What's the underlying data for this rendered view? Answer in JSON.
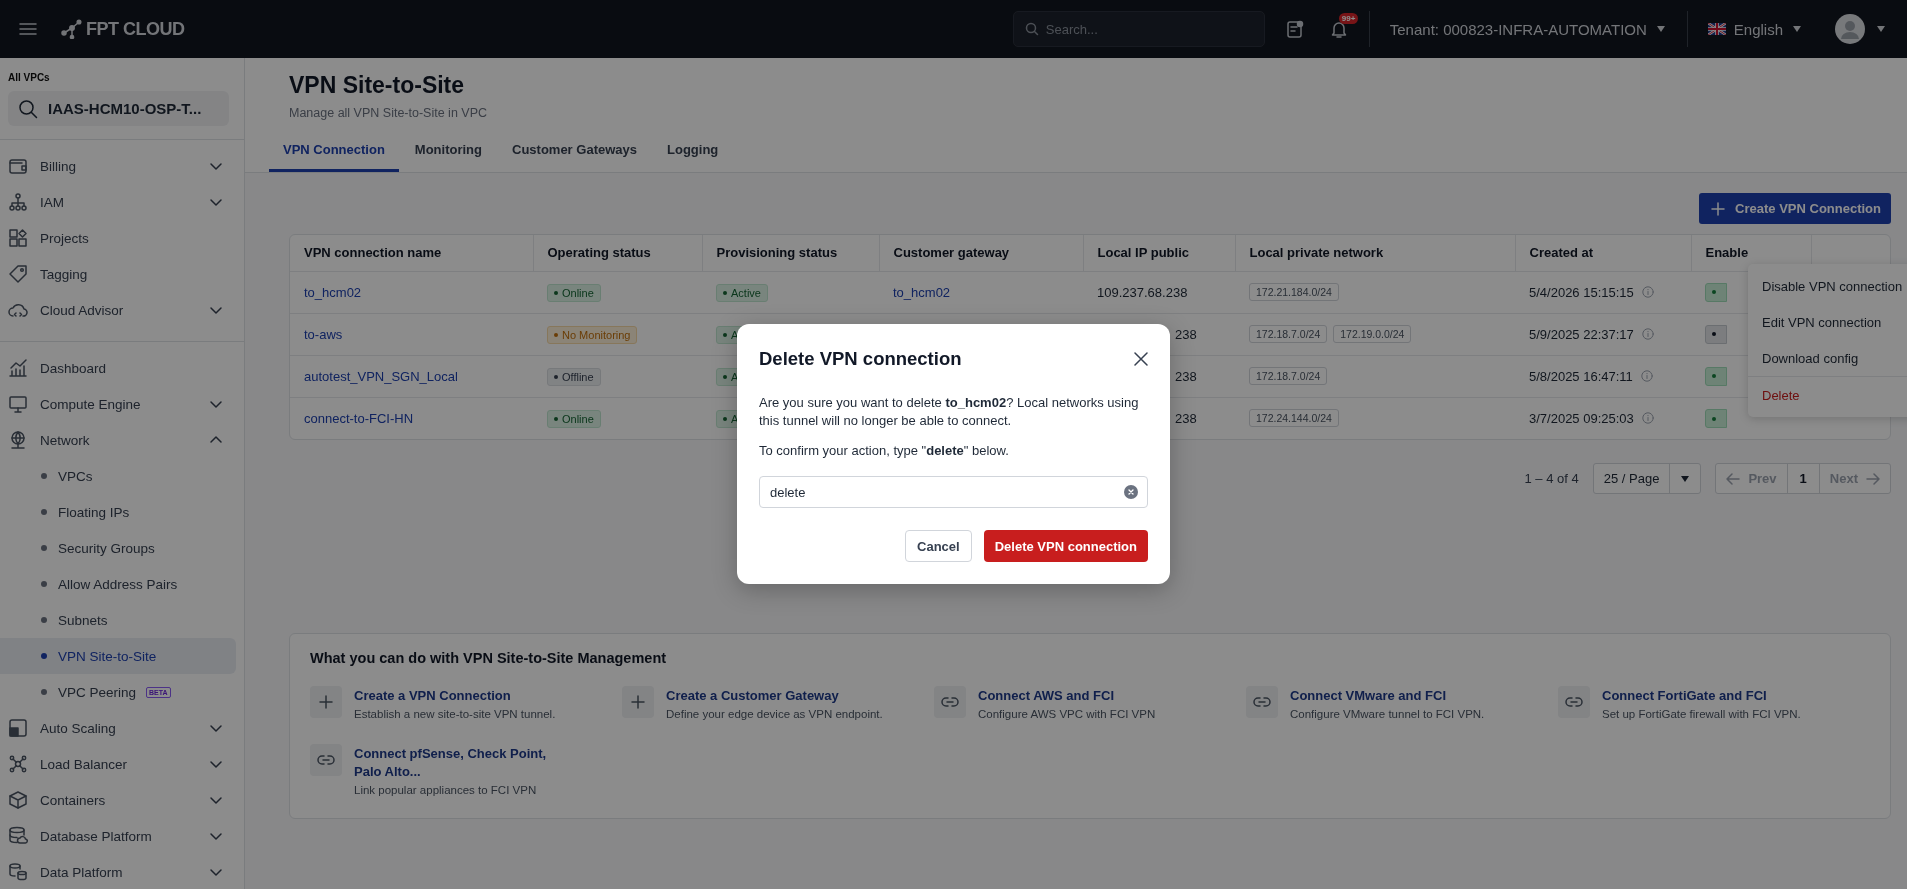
{
  "topbar": {
    "logo": "FPT CLOUD",
    "search": {
      "placeholder": "Search..."
    },
    "notifications": "99+",
    "tenant": "Tenant:  000823-INFRA-AUTOMATION",
    "language": "English"
  },
  "sidebar": {
    "scope_label": "All VPCs",
    "vpc_selector": "IAAS-HCM10-OSP-T...",
    "groups": [
      [
        {
          "label": "Billing",
          "kind": "group",
          "expanded": false
        },
        {
          "label": "IAM",
          "kind": "group",
          "expanded": false
        },
        {
          "label": "Projects",
          "kind": "link"
        },
        {
          "label": "Tagging",
          "kind": "link"
        },
        {
          "label": "Cloud Advisor",
          "kind": "group",
          "expanded": false
        }
      ],
      [
        {
          "label": "Dashboard",
          "kind": "link"
        },
        {
          "label": "Compute Engine",
          "kind": "group",
          "expanded": false
        },
        {
          "label": "Network",
          "kind": "group",
          "expanded": true,
          "children": [
            {
              "label": "VPCs",
              "selected": false
            },
            {
              "label": "Floating IPs",
              "selected": false
            },
            {
              "label": "Security Groups",
              "selected": false
            },
            {
              "label": "Allow Address Pairs",
              "selected": false
            },
            {
              "label": "Subnets",
              "selected": false
            },
            {
              "label": "VPN Site-to-Site",
              "selected": true
            },
            {
              "label": "VPC Peering",
              "selected": false,
              "badge": "BETA"
            }
          ]
        },
        {
          "label": "Auto Scaling",
          "kind": "group",
          "expanded": false
        },
        {
          "label": "Load Balancer",
          "kind": "group",
          "expanded": false
        },
        {
          "label": "Containers",
          "kind": "group",
          "expanded": false
        },
        {
          "label": "Database Platform",
          "kind": "group",
          "expanded": false
        },
        {
          "label": "Data Platform",
          "kind": "group",
          "expanded": false
        }
      ]
    ]
  },
  "page": {
    "title": "VPN Site-to-Site",
    "subtitle": "Manage all VPN Site-to-Site in VPC",
    "tabs": [
      {
        "label": "VPN Connection",
        "selected": true
      },
      {
        "label": "Monitoring",
        "selected": false
      },
      {
        "label": "Customer Gateways",
        "selected": false
      },
      {
        "label": "Logging",
        "selected": false
      }
    ],
    "create_button": "Create VPN Connection"
  },
  "table": {
    "columns": [
      "VPN connection name",
      "Operating status",
      "Provisioning status",
      "Customer gateway",
      "Local IP public",
      "Local private network",
      "Created at",
      "Enable"
    ],
    "rows": [
      {
        "name": "to_hcm02",
        "operating": {
          "kind": "online",
          "text": "Online"
        },
        "provisioning": {
          "kind": "active",
          "text": "Active"
        },
        "gateway": "to_hcm02",
        "local_ip": "109.237.68.238",
        "networks": [
          "172.21.184.0/24"
        ],
        "created": "5/4/2026 15:15:15",
        "enabled": true
      },
      {
        "name": "to-aws",
        "operating": {
          "kind": "warning",
          "text": "No Monitoring"
        },
        "provisioning": {
          "kind": "active",
          "text": "A"
        },
        "local_ip_tail": "238",
        "networks": [
          "172.18.7.0/24",
          "172.19.0.0/24"
        ],
        "created": "5/9/2025 22:37:17",
        "enabled": false
      },
      {
        "name": "autotest_VPN_SGN_Local",
        "operating": {
          "kind": "offline",
          "text": "Offline"
        },
        "provisioning": {
          "kind": "active",
          "text": "A"
        },
        "local_ip_tail": "238",
        "networks": [
          "172.18.7.0/24"
        ],
        "created": "5/8/2025 16:47:11",
        "enabled": true
      },
      {
        "name": "connect-to-FCI-HN",
        "operating": {
          "kind": "online",
          "text": "Online"
        },
        "provisioning": {
          "kind": "active",
          "text": "A"
        },
        "local_ip_tail": "238",
        "networks": [
          "172.24.144.0/24"
        ],
        "created": "3/7/2025 09:25:03",
        "enabled": true
      }
    ]
  },
  "pagination": {
    "range": "1 – 4 of 4",
    "page_size": "25 / Page",
    "prev": "Prev",
    "current": "1",
    "next": "Next"
  },
  "row_menu": [
    {
      "label": "Disable VPN connection",
      "kind": "normal"
    },
    {
      "label": "Edit VPN connection",
      "kind": "normal"
    },
    {
      "label": "Download config",
      "kind": "normal"
    },
    {
      "label": "Delete",
      "kind": "danger"
    }
  ],
  "guide": {
    "title": "What you can do with VPN Site-to-Site Management",
    "actions": [
      {
        "kind": "plus",
        "title": "Create a VPN Connection",
        "description": "Establish a new site-to-site VPN tunnel."
      },
      {
        "kind": "plus",
        "title": "Create a Customer Gateway",
        "description": "Define your edge device as VPN endpoint."
      },
      {
        "kind": "link",
        "title": "Connect AWS and FCI",
        "description": "Configure AWS VPC with FCI VPN"
      },
      {
        "kind": "link",
        "title": "Connect VMware and FCI",
        "description": "Configure VMware tunnel to FCI VPN."
      },
      {
        "kind": "link",
        "title": "Connect FortiGate and FCI",
        "description": "Set up FortiGate firewall with FCI VPN."
      },
      {
        "kind": "link",
        "title": "Connect pfSense, Check Point, Palo Alto...",
        "description": "Link popular appliances to FCI VPN"
      }
    ]
  },
  "dialog": {
    "title": "Delete VPN connection",
    "message": "Are you sure you want to delete **to_hcm02**? Local networks using this tunnel will no longer be able to connect.",
    "instruction": "To confirm your action, type \"**delete**\" below.",
    "input_value": "delete",
    "cancel": "Cancel",
    "confirm": "Delete VPN connection"
  }
}
